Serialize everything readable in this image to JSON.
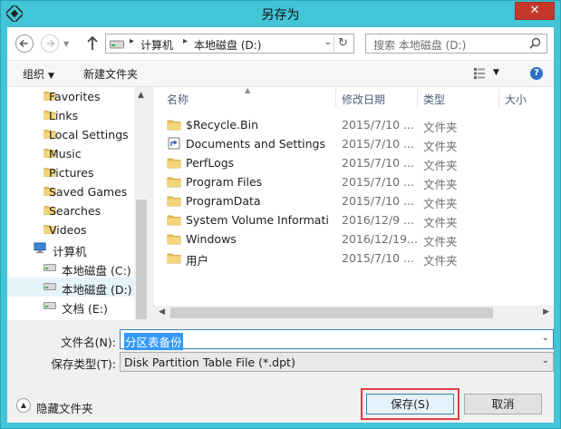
{
  "window": {
    "title": "另存为",
    "close_label": "✕"
  },
  "address": {
    "segments": [
      "计算机",
      "本地磁盘 (D:)"
    ],
    "separator": "▸",
    "dropdown": "⌄",
    "refresh": "↻"
  },
  "search": {
    "placeholder": "搜索 本地磁盘 (D:)"
  },
  "toolbar": {
    "organize": "组织",
    "organize_caret": "▼",
    "new_folder": "新建文件夹",
    "view_caret": "▼",
    "help": "?"
  },
  "tree": {
    "items": [
      {
        "label": "Favorites",
        "icon": "folder"
      },
      {
        "label": "Links",
        "icon": "folder"
      },
      {
        "label": "Local Settings",
        "icon": "folder"
      },
      {
        "label": "Music",
        "icon": "folder"
      },
      {
        "label": "Pictures",
        "icon": "folder"
      },
      {
        "label": "Saved Games",
        "icon": "folder"
      },
      {
        "label": "Searches",
        "icon": "folder"
      },
      {
        "label": "Videos",
        "icon": "folder"
      },
      {
        "label": "计算机",
        "icon": "computer"
      },
      {
        "label": "本地磁盘 (C:)",
        "icon": "drive"
      },
      {
        "label": "本地磁盘 (D:)",
        "icon": "drive",
        "selected": true
      },
      {
        "label": "文档 (E:)",
        "icon": "drive"
      }
    ]
  },
  "columns": {
    "name": "名称",
    "date": "修改日期",
    "type": "类型",
    "size": "大小"
  },
  "files": [
    {
      "name": "$Recycle.Bin",
      "date": "2015/7/10 ...",
      "type": "文件夹",
      "icon": "folder"
    },
    {
      "name": "Documents and Settings",
      "date": "2015/7/10 ...",
      "type": "文件夹",
      "icon": "shortcut"
    },
    {
      "name": "PerfLogs",
      "date": "2015/7/10 ...",
      "type": "文件夹",
      "icon": "folder"
    },
    {
      "name": "Program Files",
      "date": "2015/7/10 ...",
      "type": "文件夹",
      "icon": "folder"
    },
    {
      "name": "ProgramData",
      "date": "2015/7/10 ...",
      "type": "文件夹",
      "icon": "folder"
    },
    {
      "name": "System Volume Informati...",
      "date": "2016/12/9 ...",
      "type": "文件夹",
      "icon": "folder"
    },
    {
      "name": "Windows",
      "date": "2016/12/19...",
      "type": "文件夹",
      "icon": "folder"
    },
    {
      "name": "用户",
      "date": "2015/7/10 ...",
      "type": "文件夹",
      "icon": "folder"
    }
  ],
  "form": {
    "filename_label": "文件名(N):",
    "filename_value": "分区表备份",
    "filetype_label": "保存类型(T):",
    "filetype_value": "Disk Partition Table File (*.dpt)",
    "dropdown": "⌄",
    "hide_folders": "隐藏文件夹",
    "hide_folders_arrow": "▲",
    "save_label": "保存(S)",
    "cancel_label": "取消"
  },
  "colors": {
    "accent": "#42c5d6",
    "folder": "#e8c25c",
    "selection": "#3399ff",
    "highlight": "#e03d3d",
    "close": "#c7382c"
  }
}
